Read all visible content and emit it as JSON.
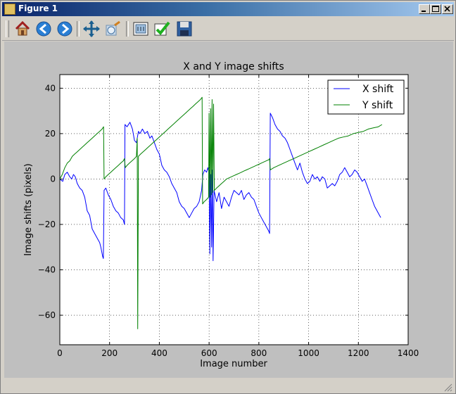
{
  "window": {
    "title": "Figure 1"
  },
  "toolbar": {
    "buttons": [
      {
        "icon": "home-icon"
      },
      {
        "icon": "back-arrow-icon"
      },
      {
        "icon": "forward-arrow-icon"
      },
      {
        "icon": "pan-icon"
      },
      {
        "icon": "zoom-icon"
      },
      {
        "icon": "configure-subplots-icon"
      },
      {
        "icon": "checkmark-icon"
      },
      {
        "icon": "save-icon"
      }
    ]
  },
  "colors": {
    "titlebar_start": "#0a246a",
    "figure_bg": "#bfbfbf",
    "x_series": "#0000ff",
    "y_series": "#008000"
  },
  "chart_data": {
    "type": "line",
    "title": "X and Y image shifts",
    "xlabel": "Image number",
    "ylabel": "Image shifts (pixels)",
    "xlim": [
      0,
      1400
    ],
    "ylim": [
      -73,
      46
    ],
    "xticks": [
      0,
      200,
      400,
      600,
      800,
      1000,
      1200,
      1400
    ],
    "yticks": [
      -60,
      -40,
      -20,
      0,
      20,
      40
    ],
    "grid": true,
    "legend_position": "top-right",
    "series": [
      {
        "name": "X shift",
        "color": "#0000ff",
        "points": [
          [
            0,
            0
          ],
          [
            5,
            -0.5
          ],
          [
            12,
            -1
          ],
          [
            20,
            2
          ],
          [
            30,
            3
          ],
          [
            40,
            1
          ],
          [
            48,
            0
          ],
          [
            55,
            2
          ],
          [
            62,
            1
          ],
          [
            70,
            -2
          ],
          [
            80,
            -4
          ],
          [
            90,
            -5
          ],
          [
            100,
            -8
          ],
          [
            110,
            -14
          ],
          [
            120,
            -16
          ],
          [
            130,
            -22
          ],
          [
            140,
            -24
          ],
          [
            150,
            -26
          ],
          [
            160,
            -28
          ],
          [
            165,
            -30
          ],
          [
            172,
            -34
          ],
          [
            175,
            -35
          ],
          [
            178,
            -5
          ],
          [
            185,
            -4
          ],
          [
            195,
            -7
          ],
          [
            205,
            -9
          ],
          [
            215,
            -12
          ],
          [
            225,
            -14
          ],
          [
            235,
            -15
          ],
          [
            245,
            -17
          ],
          [
            255,
            -18
          ],
          [
            260,
            -20
          ],
          [
            262,
            24
          ],
          [
            270,
            23
          ],
          [
            282,
            25
          ],
          [
            292,
            22
          ],
          [
            300,
            17
          ],
          [
            308,
            16
          ],
          [
            316,
            21
          ],
          [
            322,
            20
          ],
          [
            332,
            22
          ],
          [
            342,
            20
          ],
          [
            352,
            21
          ],
          [
            362,
            18
          ],
          [
            370,
            19
          ],
          [
            380,
            16
          ],
          [
            390,
            13
          ],
          [
            400,
            11
          ],
          [
            410,
            6
          ],
          [
            420,
            4
          ],
          [
            430,
            3
          ],
          [
            440,
            1
          ],
          [
            450,
            -2
          ],
          [
            460,
            -4
          ],
          [
            470,
            -6
          ],
          [
            480,
            -10
          ],
          [
            490,
            -12
          ],
          [
            500,
            -13
          ],
          [
            510,
            -15
          ],
          [
            520,
            -17
          ],
          [
            530,
            -15
          ],
          [
            540,
            -13
          ],
          [
            550,
            -12
          ],
          [
            560,
            -10
          ],
          [
            570,
            -5
          ],
          [
            575,
            2
          ],
          [
            582,
            4
          ],
          [
            590,
            3
          ],
          [
            595,
            5
          ],
          [
            600,
            3
          ],
          [
            603,
            -33
          ],
          [
            606,
            2
          ],
          [
            610,
            -30
          ],
          [
            613,
            4
          ],
          [
            616,
            -36
          ],
          [
            620,
            -5
          ],
          [
            630,
            -10
          ],
          [
            640,
            -6
          ],
          [
            650,
            -13
          ],
          [
            660,
            -8
          ],
          [
            670,
            -10
          ],
          [
            680,
            -12
          ],
          [
            690,
            -8
          ],
          [
            700,
            -5
          ],
          [
            710,
            -6
          ],
          [
            720,
            -7
          ],
          [
            730,
            -5
          ],
          [
            740,
            -9
          ],
          [
            750,
            -7
          ],
          [
            760,
            -6
          ],
          [
            770,
            -8
          ],
          [
            780,
            -9
          ],
          [
            790,
            -12
          ],
          [
            800,
            -15
          ],
          [
            810,
            -17
          ],
          [
            820,
            -19
          ],
          [
            830,
            -21
          ],
          [
            840,
            -23
          ],
          [
            843,
            -24
          ],
          [
            846,
            29
          ],
          [
            855,
            27
          ],
          [
            865,
            24
          ],
          [
            875,
            22
          ],
          [
            885,
            21
          ],
          [
            895,
            19
          ],
          [
            905,
            18
          ],
          [
            915,
            16
          ],
          [
            925,
            13
          ],
          [
            935,
            10
          ],
          [
            945,
            7
          ],
          [
            955,
            4
          ],
          [
            965,
            7
          ],
          [
            975,
            3
          ],
          [
            985,
            0
          ],
          [
            995,
            -2
          ],
          [
            1005,
            -1
          ],
          [
            1015,
            2
          ],
          [
            1025,
            0
          ],
          [
            1035,
            1
          ],
          [
            1045,
            -1
          ],
          [
            1055,
            1
          ],
          [
            1065,
            0
          ],
          [
            1075,
            -4
          ],
          [
            1085,
            -3
          ],
          [
            1095,
            -2
          ],
          [
            1105,
            -3
          ],
          [
            1115,
            -1
          ],
          [
            1125,
            2
          ],
          [
            1135,
            3
          ],
          [
            1145,
            5
          ],
          [
            1155,
            3
          ],
          [
            1165,
            1
          ],
          [
            1175,
            2
          ],
          [
            1185,
            4
          ],
          [
            1195,
            3
          ],
          [
            1205,
            1
          ],
          [
            1215,
            -1
          ],
          [
            1225,
            0
          ],
          [
            1235,
            -3
          ],
          [
            1245,
            -6
          ],
          [
            1255,
            -9
          ],
          [
            1265,
            -12
          ],
          [
            1275,
            -14
          ],
          [
            1285,
            -16
          ],
          [
            1290,
            -17
          ]
        ]
      },
      {
        "name": "Y shift",
        "color": "#008000",
        "points": [
          [
            0,
            0
          ],
          [
            10,
            2
          ],
          [
            20,
            5
          ],
          [
            30,
            7
          ],
          [
            40,
            8
          ],
          [
            50,
            10
          ],
          [
            60,
            11
          ],
          [
            70,
            12
          ],
          [
            80,
            13
          ],
          [
            90,
            14
          ],
          [
            100,
            15
          ],
          [
            110,
            16
          ],
          [
            120,
            17
          ],
          [
            130,
            18
          ],
          [
            140,
            19
          ],
          [
            150,
            20
          ],
          [
            160,
            21
          ],
          [
            170,
            22
          ],
          [
            176,
            23
          ],
          [
            178,
            0
          ],
          [
            185,
            1
          ],
          [
            195,
            2
          ],
          [
            205,
            3
          ],
          [
            215,
            4
          ],
          [
            225,
            5
          ],
          [
            235,
            6
          ],
          [
            245,
            7
          ],
          [
            255,
            8
          ],
          [
            260,
            9
          ],
          [
            263,
            5
          ],
          [
            270,
            6
          ],
          [
            280,
            7
          ],
          [
            290,
            8
          ],
          [
            300,
            9
          ],
          [
            308,
            10
          ],
          [
            311,
            18
          ],
          [
            313,
            -66
          ],
          [
            316,
            10
          ],
          [
            325,
            11
          ],
          [
            335,
            12
          ],
          [
            345,
            13
          ],
          [
            355,
            14
          ],
          [
            365,
            15
          ],
          [
            375,
            16
          ],
          [
            385,
            17
          ],
          [
            395,
            18
          ],
          [
            405,
            19
          ],
          [
            415,
            20
          ],
          [
            425,
            21
          ],
          [
            435,
            22
          ],
          [
            445,
            23
          ],
          [
            455,
            24
          ],
          [
            465,
            25
          ],
          [
            475,
            26
          ],
          [
            485,
            27
          ],
          [
            495,
            28
          ],
          [
            505,
            29
          ],
          [
            515,
            30
          ],
          [
            525,
            31
          ],
          [
            535,
            32
          ],
          [
            545,
            33
          ],
          [
            555,
            34
          ],
          [
            565,
            35
          ],
          [
            572,
            36
          ],
          [
            574,
            -11
          ],
          [
            580,
            -10
          ],
          [
            590,
            -9
          ],
          [
            598,
            -8
          ],
          [
            600,
            29
          ],
          [
            603,
            -8
          ],
          [
            606,
            31
          ],
          [
            609,
            -7
          ],
          [
            612,
            35
          ],
          [
            615,
            -6
          ],
          [
            618,
            33
          ],
          [
            621,
            -5
          ],
          [
            630,
            -4
          ],
          [
            640,
            -3
          ],
          [
            650,
            -2
          ],
          [
            660,
            -1
          ],
          [
            670,
            0
          ],
          [
            680,
            0.5
          ],
          [
            690,
            1
          ],
          [
            700,
            1.5
          ],
          [
            710,
            2
          ],
          [
            720,
            2.5
          ],
          [
            730,
            3
          ],
          [
            740,
            3.5
          ],
          [
            750,
            4
          ],
          [
            760,
            4.5
          ],
          [
            770,
            5
          ],
          [
            780,
            5.5
          ],
          [
            790,
            6
          ],
          [
            800,
            6.5
          ],
          [
            810,
            7
          ],
          [
            820,
            7.5
          ],
          [
            830,
            8
          ],
          [
            840,
            8.5
          ],
          [
            843,
            9
          ],
          [
            846,
            4
          ],
          [
            860,
            5
          ],
          [
            880,
            6
          ],
          [
            900,
            7
          ],
          [
            920,
            8
          ],
          [
            940,
            9
          ],
          [
            960,
            10
          ],
          [
            980,
            11
          ],
          [
            1000,
            12
          ],
          [
            1020,
            13
          ],
          [
            1040,
            14
          ],
          [
            1060,
            15
          ],
          [
            1080,
            16
          ],
          [
            1100,
            17
          ],
          [
            1120,
            18
          ],
          [
            1140,
            18.5
          ],
          [
            1160,
            19
          ],
          [
            1180,
            20
          ],
          [
            1200,
            20.5
          ],
          [
            1220,
            21
          ],
          [
            1240,
            22
          ],
          [
            1260,
            22.5
          ],
          [
            1280,
            23
          ],
          [
            1295,
            24
          ]
        ]
      }
    ]
  }
}
